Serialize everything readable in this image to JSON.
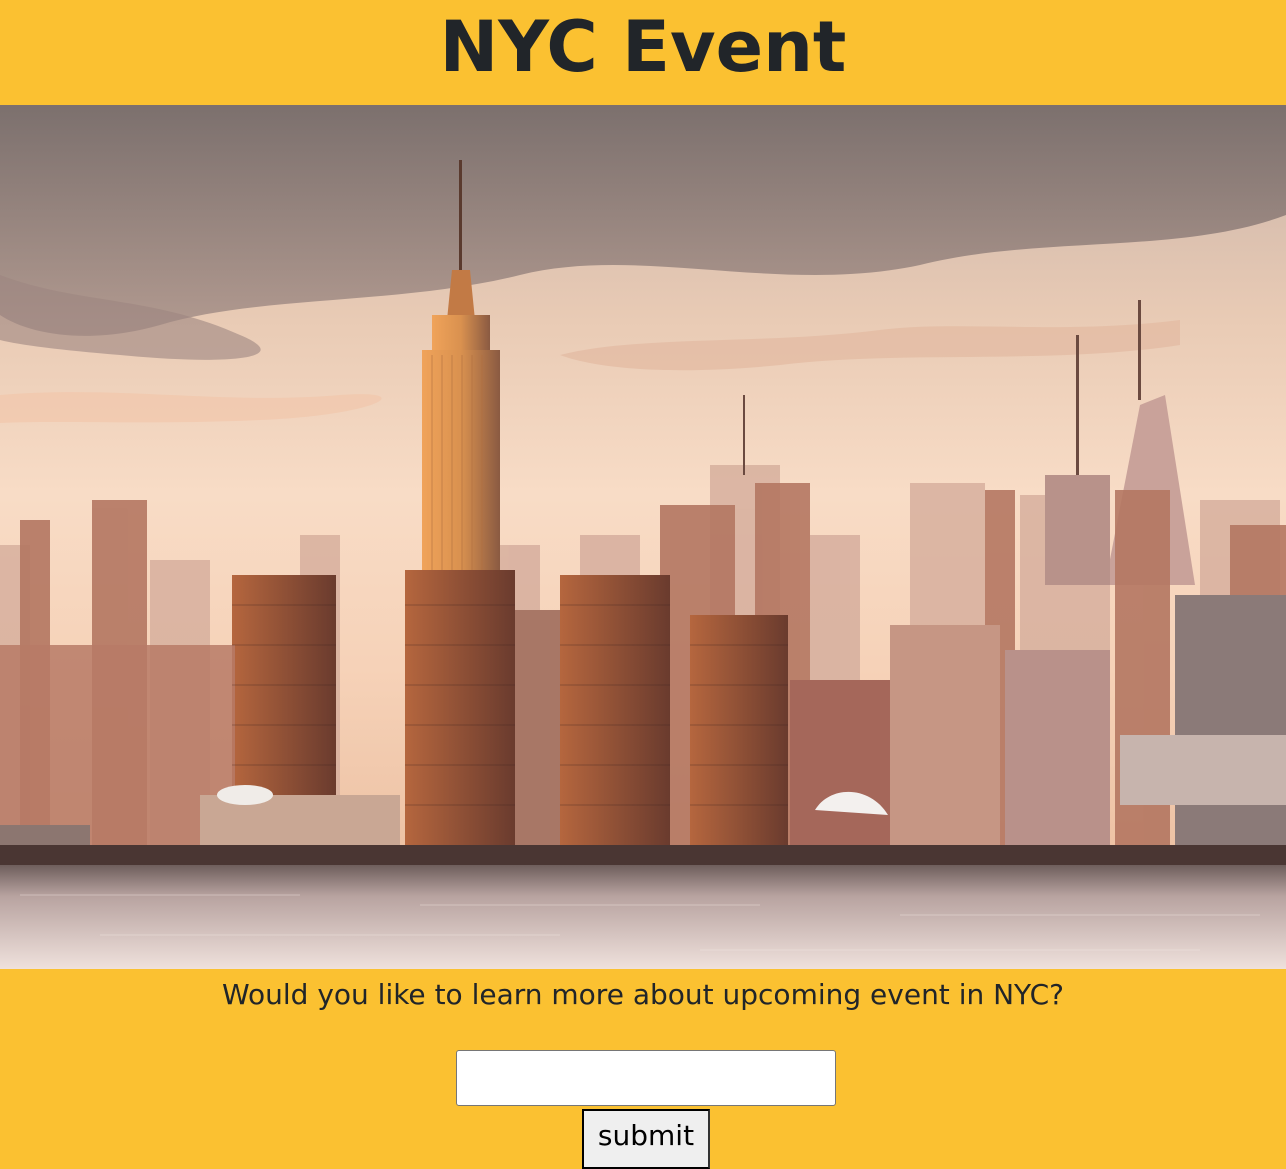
{
  "header": {
    "title": "NYC Event"
  },
  "hero": {
    "image_alt": "New York City skyline at sunset"
  },
  "form": {
    "question": "Would you like to learn more about upcoming event in NYC?",
    "input_value": "",
    "input_placeholder": "",
    "submit_label": "submit"
  },
  "colors": {
    "background": "#fbc131",
    "title_text": "#212529"
  }
}
